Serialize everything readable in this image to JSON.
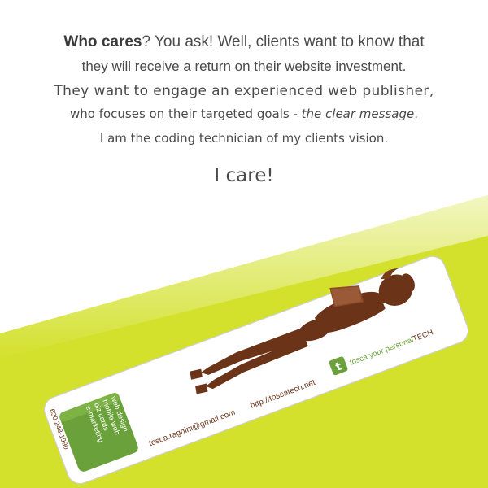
{
  "intro": {
    "who_cares": "Who cares",
    "line1_rest": "?  You ask!  Well,  clients want to know that",
    "line2": "they will receive a return on their website investment.",
    "line3": "They want to engage an experienced web publisher,",
    "line4_prefix": "who focuses on their targeted goals - ",
    "line4_emph": "the clear message",
    "line4_suffix": ".",
    "line5": "I am the coding technician of my clients vision.",
    "tagline": "I care!"
  },
  "card": {
    "services": [
      "web design",
      "mobile web",
      "biz cards",
      "e-marketing"
    ],
    "phone": "630 248-1990",
    "email": "tosca.ragnini@gmail.com",
    "website": "http://toscatech.net",
    "logo_letter": "t",
    "brand_prefix": "tosca your personal",
    "brand_suffix": "TECH"
  },
  "colors": {
    "background_band": "#d3e12d",
    "accent_green": "#6aa13a",
    "silhouette": "#6b3318",
    "text_gray": "#4a4a4a"
  }
}
